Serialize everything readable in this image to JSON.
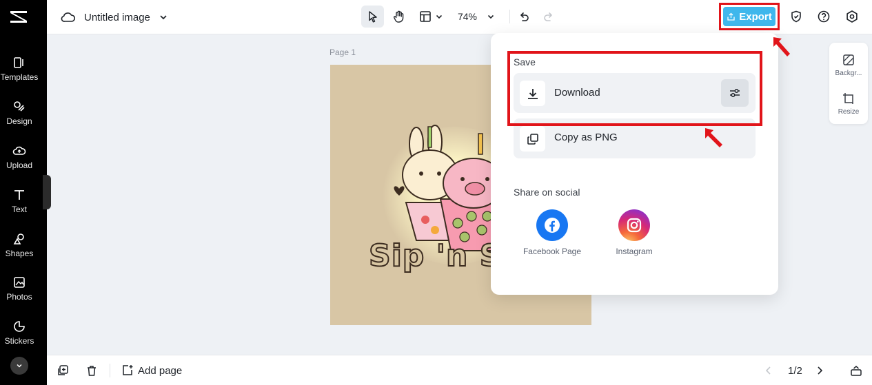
{
  "rail": {
    "items": [
      {
        "label": "Templates",
        "icon": "templates-icon"
      },
      {
        "label": "Design",
        "icon": "design-icon"
      },
      {
        "label": "Upload",
        "icon": "upload-icon"
      },
      {
        "label": "Text",
        "icon": "text-icon"
      },
      {
        "label": "Shapes",
        "icon": "shapes-icon"
      },
      {
        "label": "Photos",
        "icon": "photos-icon"
      },
      {
        "label": "Stickers",
        "icon": "stickers-icon"
      }
    ]
  },
  "header": {
    "title": "Untitled image",
    "zoom": "74%",
    "export_label": "Export"
  },
  "canvas": {
    "page_label": "Page 1",
    "artwork_text": "Sip 'n Sa"
  },
  "mini_panel": {
    "background_label": "Backgr...",
    "resize_label": "Resize"
  },
  "export_menu": {
    "save_heading": "Save",
    "download_label": "Download",
    "copy_label": "Copy as PNG",
    "share_heading": "Share on social",
    "facebook_label": "Facebook Page",
    "instagram_label": "Instagram"
  },
  "footer": {
    "add_page_label": "Add page",
    "page_counter": "1/2"
  },
  "colors": {
    "accent": "#3fb7ec",
    "highlight": "#e1141a",
    "facebook": "#1877f2"
  }
}
